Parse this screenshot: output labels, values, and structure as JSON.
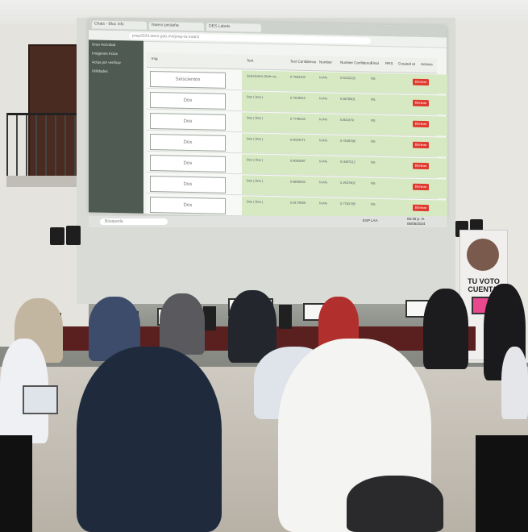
{
  "projection": {
    "tabs": [
      "Chats - Bloc info",
      "Nuevo pestaña",
      "DES Labels"
    ],
    "address": "prep2024.ieem.gob.mx/prep-la-matriz",
    "sidebar_items": [
      "Gran Actividad",
      "Imágenes Actas",
      "Actas por verificar",
      "Utilidades"
    ],
    "headers": [
      "Img",
      "Text",
      "Text Confidence",
      "Number",
      "Number Confidence",
      "Final",
      "RRS",
      "Created at",
      "Actions"
    ],
    "rows": [
      {
        "sig": "Seiscientos",
        "text": "Seiscientos (Seis va...",
        "conf": "0.7553333",
        "num": "N.A%",
        "numconf": "0.5323333",
        "final": "NS"
      },
      {
        "sig": "Dos",
        "text": "Dos ( Dos )",
        "conf": "0.7619810",
        "num": "N.A%",
        "numconf": "0.6678901",
        "final": "NS"
      },
      {
        "sig": "Dos",
        "text": "Dos ( Dos )",
        "conf": "0.7748343",
        "num": "N.A%",
        "numconf": "0.801679",
        "final": "NS"
      },
      {
        "sig": "Dos",
        "text": "Dos ( Dos )",
        "conf": "0.9034271",
        "num": "N.A%",
        "numconf": "0.7649788",
        "final": "NS"
      },
      {
        "sig": "Dos",
        "text": "Dos ( Dos )",
        "conf": "0.9053097",
        "num": "N.A%",
        "numconf": "0.0087012",
        "final": "NS"
      },
      {
        "sig": "Dos",
        "text": "Dos ( Dos )",
        "conf": "0.8846933",
        "num": "N.A%",
        "numconf": "0.2537902",
        "final": "NS"
      },
      {
        "sig": "Dos",
        "text": "Dos ( Dos )",
        "conf": "0.9174559",
        "num": "N.A%",
        "numconf": "0.7782785",
        "final": "NS"
      }
    ],
    "button_label": "Eliminar",
    "taskbar_search": "Búsqueda",
    "clock": "06:36 p. m.",
    "date": "06/06/2024",
    "lang": "ESP LAA"
  },
  "banner": {
    "text": "TU VOTO CUENTA."
  },
  "colors": {
    "table_cloth": "#5a1f1f",
    "green_cell": "#d6e9c2",
    "delete_button": "#e03a2f"
  }
}
